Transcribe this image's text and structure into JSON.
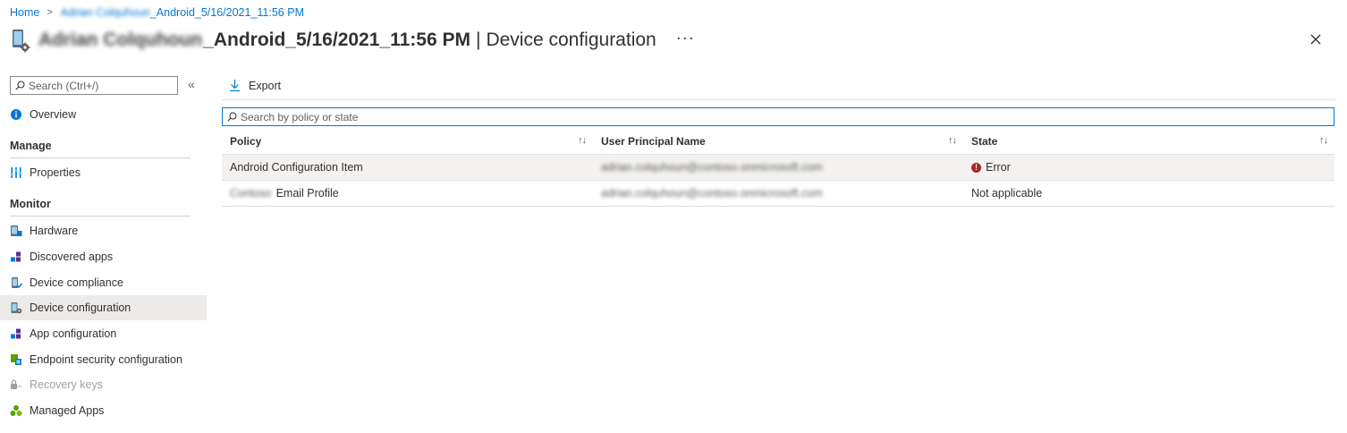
{
  "breadcrumb": {
    "home": "Home",
    "device_blurred": "Adrian Colquhoun",
    "device_suffix": "_Android_5/16/2021_11:56 PM"
  },
  "header": {
    "title_blurred": "Adrian Colquhoun",
    "title_suffix": "_Android_5/16/2021_11:56 PM",
    "separator": "|",
    "blade": "Device configuration",
    "more": "···"
  },
  "sidebar": {
    "search_placeholder": "Search (Ctrl+/)",
    "collapse": "«",
    "overview": "Overview",
    "manage_heading": "Manage",
    "manage_items": [
      "Properties"
    ],
    "monitor_heading": "Monitor",
    "monitor_items": [
      "Hardware",
      "Discovered apps",
      "Device compliance",
      "Device configuration",
      "App configuration",
      "Endpoint security configuration",
      "Recovery keys",
      "Managed Apps"
    ],
    "active_item": "Device configuration",
    "disabled_item": "Recovery keys"
  },
  "toolbar": {
    "export_label": "Export"
  },
  "grid": {
    "search_placeholder": "Search by policy or state",
    "columns": [
      "Policy",
      "User Principal Name",
      "State"
    ],
    "sort_glyph": "↑↓",
    "rows": [
      {
        "policy_blurred": "",
        "policy": "Android Configuration Item",
        "upn": "adrian.colquhoun@contoso.onmicrosoft.com",
        "state": "Error",
        "state_icon": "error-icon"
      },
      {
        "policy_blurred": "Contoso",
        "policy": "Email Profile",
        "upn": "adrian.colquhoun@contoso.onmicrosoft.com",
        "state": "Not applicable",
        "state_icon": ""
      }
    ]
  },
  "colors": {
    "accent": "#0078d4",
    "error": "#a4262c",
    "selected_row": "#f3f2f1",
    "active_nav": "#edebe9"
  }
}
